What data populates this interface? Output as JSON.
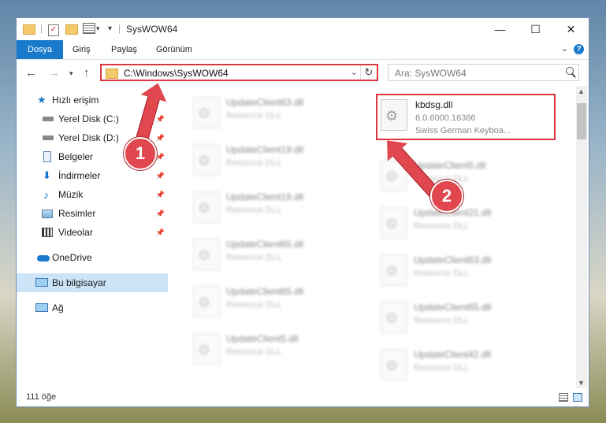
{
  "window": {
    "title": "SysWOW64"
  },
  "ribbon": {
    "tabs": [
      "Dosya",
      "Giriş",
      "Paylaş",
      "Görünüm"
    ]
  },
  "window_controls": {
    "minimize": "—",
    "maximize": "☐",
    "close": "✕"
  },
  "address_bar": {
    "path": "C:\\Windows\\SysWOW64"
  },
  "search": {
    "placeholder": "Ara: SysWOW64"
  },
  "sidebar": {
    "items": [
      {
        "label": "Hızlı erişim",
        "icon": "star-icon"
      },
      {
        "label": "Yerel Disk (C:)",
        "icon": "drive-icon",
        "pinned": true
      },
      {
        "label": "Yerel Disk (D:)",
        "icon": "drive-icon",
        "pinned": true
      },
      {
        "label": "Belgeler",
        "icon": "documents-icon",
        "pinned": true
      },
      {
        "label": "İndirmeler",
        "icon": "download-icon",
        "pinned": true
      },
      {
        "label": "Müzik",
        "icon": "music-icon",
        "pinned": true
      },
      {
        "label": "Resimler",
        "icon": "pictures-icon",
        "pinned": true
      },
      {
        "label": "Videolar",
        "icon": "videos-icon",
        "pinned": true
      },
      {
        "label": "OneDrive",
        "icon": "cloud-icon"
      },
      {
        "label": "Bu bilgisayar",
        "icon": "computer-icon",
        "selected": true
      },
      {
        "label": "Ağ",
        "icon": "network-icon"
      }
    ]
  },
  "files": {
    "highlighted": {
      "name": "kbdsg.dll",
      "version": "6.0.6000.16386",
      "description": "Swiss German Keyboa..."
    },
    "left_column": [
      {
        "name": "UpdateClient63.dll",
        "type": "Resource DLL"
      },
      {
        "name": "UpdateClient19.dll",
        "type": "Resource DLL"
      },
      {
        "name": "UpdateClient19.dll",
        "type": "Resource DLL"
      },
      {
        "name": "UpdateClient65.dll",
        "type": "Resource DLL"
      },
      {
        "name": "UpdateClient65.dll",
        "type": "Resource DLL"
      },
      {
        "name": "UpdateClient5.dll",
        "type": "Resource DLL"
      }
    ],
    "right_column": [
      {
        "name": "UpdateClient5.dll",
        "type": "Resource DLL"
      },
      {
        "name": "UpdateClient21.dll",
        "type": "Resource DLL"
      },
      {
        "name": "UpdateClient63.dll",
        "type": "Resource DLL"
      },
      {
        "name": "UpdateClient65.dll",
        "type": "Resource DLL"
      },
      {
        "name": "UpdateClient42.dll",
        "type": "Resource DLL"
      }
    ]
  },
  "status_bar": {
    "item_count": "111 öğe"
  },
  "annotations": {
    "badge1": "1",
    "badge2": "2"
  },
  "colors": {
    "accent": "#1979ca",
    "highlight": "#d9363e",
    "annotation": "#e0474e",
    "selected": "#cce4f7"
  }
}
